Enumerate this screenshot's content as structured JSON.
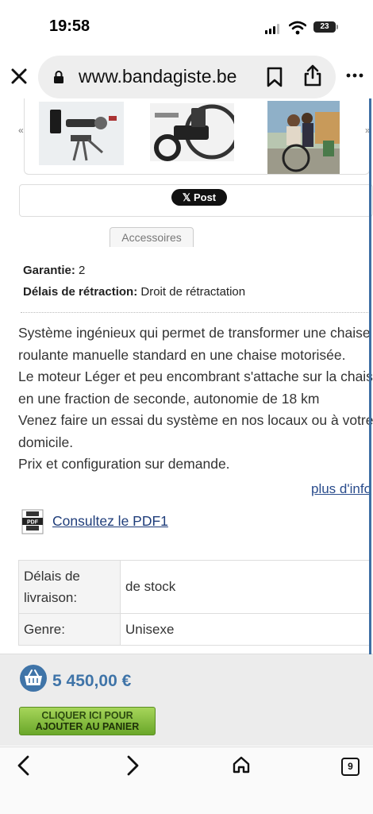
{
  "status_bar": {
    "time": "19:58",
    "battery": "23"
  },
  "browser": {
    "url": "www.bandagiste.be"
  },
  "gallery": {
    "prev_arrow": "«",
    "next_arrow": "»"
  },
  "share": {
    "post_label": "Post"
  },
  "tabs": {
    "accessoires": "Accessoires"
  },
  "specs": {
    "garantie_label": "Garantie:",
    "garantie_value": "2",
    "retraction_label": "Délais de rétraction:",
    "retraction_value": "Droit de rétractation"
  },
  "description": {
    "lines": [
      "Système ingénieux qui permet de transformer une chaise",
      "roulante manuelle standard en une chaise motorisée.",
      "Le moteur Léger et peu encombrant s'attache sur la chaise",
      "en une fraction de seconde, autonomie de 18 km",
      "Venez faire un essai du système en nos locaux ou à votre",
      "domicile.",
      "Prix et configuration sur demande."
    ],
    "more_info": "plus d'info"
  },
  "pdf": {
    "icon_text": "PDF",
    "link": "Consultez le PDF1"
  },
  "info_table": {
    "rows": [
      {
        "label": "Délais de livraison:",
        "value": "de stock"
      },
      {
        "label": "Genre:",
        "value": "Unisexe"
      }
    ]
  },
  "price": {
    "amount": "5 450,00 €"
  },
  "cart": {
    "line1": "CLIQUER ICI POUR",
    "line2": "AJOUTER AU PANIER"
  },
  "toolbar": {
    "tab_count": "9"
  },
  "colors": {
    "price_blue": "#3f74a8",
    "cart_green": "#7fbd3a",
    "link_blue": "#1f3d7a"
  }
}
